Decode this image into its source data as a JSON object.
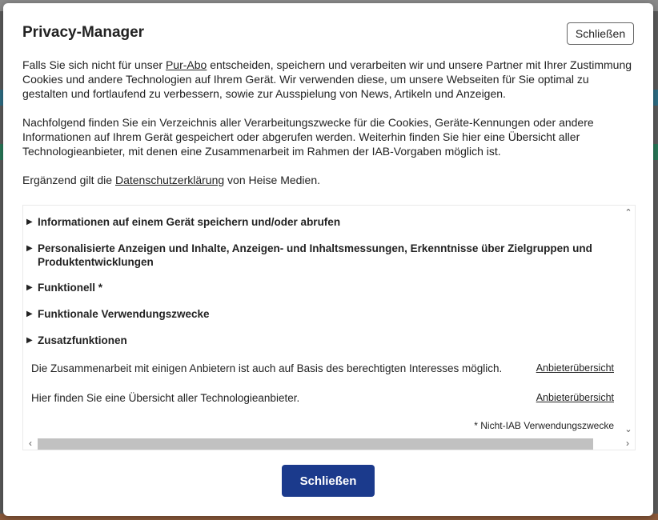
{
  "dialog": {
    "title": "Privacy-Manager",
    "close_top_label": "Schließen",
    "close_bottom_label": "Schließen"
  },
  "intro": {
    "p1_pre": "Falls Sie sich nicht für unser ",
    "p1_link": "Pur-Abo",
    "p1_post": " entscheiden, speichern und verarbeiten wir und unsere Partner mit Ihrer Zustimmung Cookies und andere Technologien auf Ihrem Gerät. Wir verwenden diese, um unsere Webseiten für Sie optimal zu gestalten und fortlaufend zu verbessern, sowie zur Ausspielung von News, Artikeln und Anzeigen.",
    "p2": "Nachfolgend finden Sie ein Verzeichnis aller Verarbeitungszwecke für die Cookies, Geräte-Kennungen oder andere Informationen auf Ihrem Gerät gespeichert oder abgerufen werden. Weiterhin finden Sie hier eine Übersicht aller Technologieanbieter, mit denen eine Zusammenarbeit im Rahmen der IAB-Vorgaben möglich ist.",
    "p3_pre": "Ergänzend gilt die ",
    "p3_link": "Datenschutzerklärung",
    "p3_post": " von Heise Medien."
  },
  "purposes": [
    {
      "label": "Informationen auf einem Gerät speichern und/oder abrufen"
    },
    {
      "label": "Personalisierte Anzeigen und Inhalte, Anzeigen- und Inhaltsmessungen, Erkenntnisse über Zielgruppen und Produktentwicklungen"
    },
    {
      "label": "Funktionell *"
    },
    {
      "label": "Funktionale Verwendungszwecke"
    },
    {
      "label": "Zusatzfunktionen"
    }
  ],
  "info_rows": [
    {
      "text": "Die Zusammenarbeit mit einigen Anbietern ist auch auf Basis des berechtigten Interesses möglich.",
      "link": "Anbieterübersicht"
    },
    {
      "text": "Hier finden Sie eine Übersicht aller Technologieanbieter.",
      "link": "Anbieterübersicht"
    }
  ],
  "footnote": "*  Nicht-IAB Verwendungszwecke",
  "icons": {
    "expand": "triangle-right-icon",
    "scroll_up": "chevron-up-icon",
    "scroll_down": "chevron-down-icon",
    "scroll_left": "chevron-left-icon",
    "scroll_right": "chevron-right-icon"
  },
  "colors": {
    "primary_button": "#1b3a8c",
    "overlay": "#5c5c5c"
  }
}
